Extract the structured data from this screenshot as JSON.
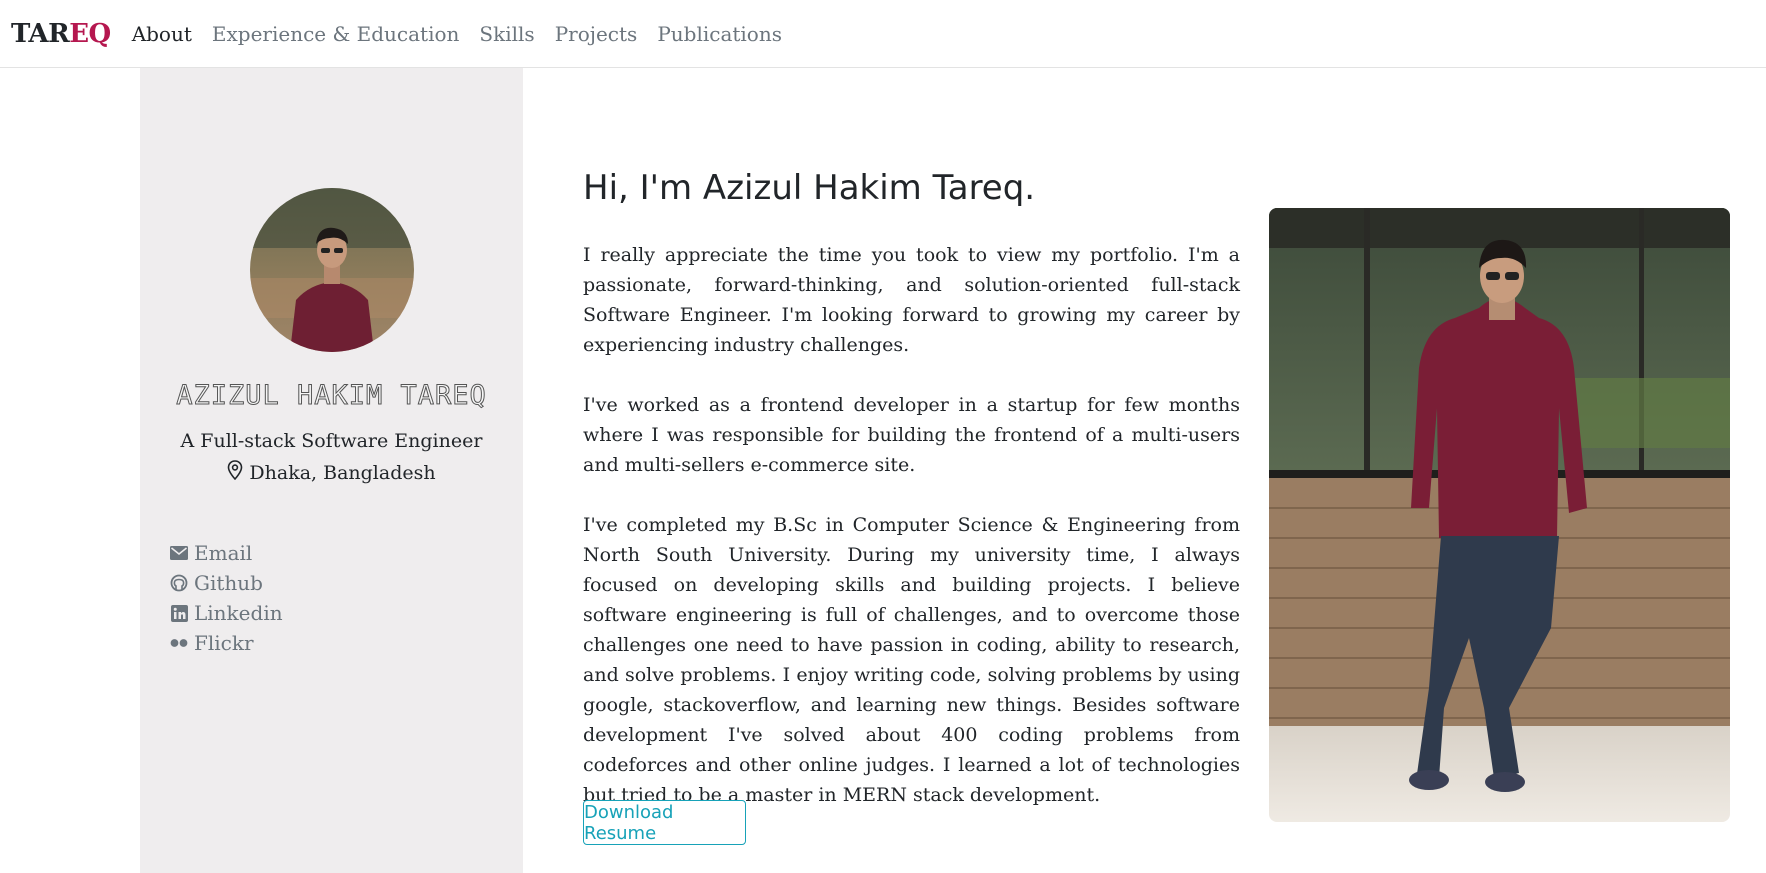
{
  "brand": {
    "part1": "TAR",
    "part2": "EQ"
  },
  "nav": [
    {
      "label": "About"
    },
    {
      "label": "Experience & Education"
    },
    {
      "label": "Skills"
    },
    {
      "label": "Projects"
    },
    {
      "label": "Publications"
    }
  ],
  "sidebar": {
    "name": "AZIZUL HAKIM TAREQ",
    "role": "A Full-stack Software Engineer",
    "location": "Dhaka, Bangladesh",
    "links": [
      {
        "label": "Email",
        "icon": "email-icon"
      },
      {
        "label": "Github",
        "icon": "github-icon"
      },
      {
        "label": "Linkedin",
        "icon": "linkedin-icon"
      },
      {
        "label": "Flickr",
        "icon": "flickr-icon"
      }
    ]
  },
  "main": {
    "greeting": "Hi, I'm Azizul Hakim Tareq.",
    "p1": "I really appreciate the time you took to view my portfolio. I'm a passionate, forward-thinking, and solution-oriented full-stack Software Engineer. I'm looking forward to growing my career by experiencing industry challenges.",
    "p2": "I've worked as a frontend developer in a startup for few months where I was responsible for building the frontend of a multi-users and multi-sellers e-commerce site.",
    "p3": "I've completed my B.Sc in Computer Science & Engineering from North South University. During my university time, I always focused on developing skills and building projects. I believe software engineering is full of challenges, and to overcome those challenges one need to have passion in coding, ability to research, and solve problems. I enjoy writing code, solving problems by using google, stackoverflow, and learning new things. Besides software development I've solved about 400 coding problems from codeforces and other online judges. I learned a lot of technologies but tried to be a master in MERN stack development.",
    "download_label": "Download Resume"
  },
  "colors": {
    "brand_accent": "#b5174f",
    "sidebar_bg": "#efedee",
    "button_accent": "#17a2b8"
  }
}
